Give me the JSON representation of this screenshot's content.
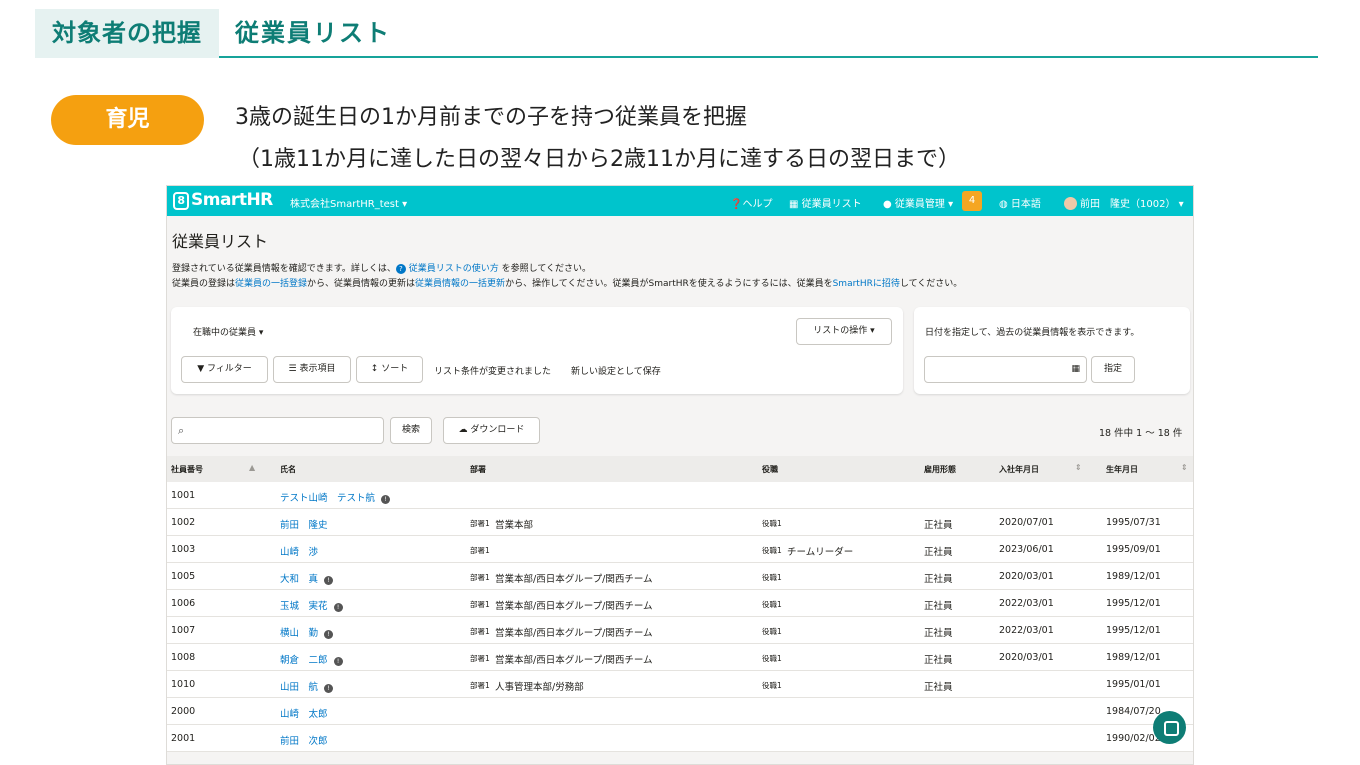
{
  "slide": {
    "tab_label": "対象者の把握",
    "title": "従業員リスト",
    "pill": "育児",
    "desc_line1": "3歳の誕生日の1か月前までの子を持つ従業員を把握",
    "desc_line2": "（1歳11か月に達した日の翌々日から2歳11か月に達する日の翌日まで）"
  },
  "app": {
    "logo": "SmartHR",
    "logo_mark": "8",
    "company": "株式会社SmartHR_test ▾",
    "nav": {
      "help": "ヘルプ",
      "employee_list": "従業員リスト",
      "employee_mgmt": "従業員管理 ▾",
      "badge": "4",
      "language": "日本語",
      "user": "前田　隆史（1002） ▾"
    },
    "page_title": "従業員リスト",
    "intro1_pre": "登録されている従業員情報を確認できます。詳しくは、",
    "intro1_link": "従業員リストの使い方",
    "intro1_post": " を参照してください。",
    "intro2_a": "従業員の登録は",
    "intro2_link1": "従業員の一括登録",
    "intro2_b": "から、従業員情報の更新は",
    "intro2_link2": "従業員情報の一括更新",
    "intro2_c": "から、操作してください。従業員がSmartHRを使えるようにするには、従業員を",
    "intro2_link3": "SmartHRに招待",
    "intro2_d": "してください。",
    "filter_panel": {
      "status_select": "在職中の従業員 ▾",
      "list_ops": "リストの操作 ▾",
      "filter": "フィルター",
      "columns": "表示項目",
      "sort": "ソート",
      "changed": "リスト条件が変更されました",
      "save_new": "新しい設定として保存"
    },
    "date_panel": {
      "text": "日付を指定して、過去の従業員情報を表示できます。",
      "apply": "指定"
    },
    "search_btn": "検索",
    "download_btn": "ダウンロード",
    "count": "18 件中 1 〜 18 件",
    "columns": [
      "社員番号",
      "氏名",
      "部署",
      "役職",
      "雇用形態",
      "入社年月日",
      "生年月日"
    ],
    "rows": [
      {
        "id": "1001",
        "name": "テスト山崎　テスト航",
        "info": true,
        "dept_label": "",
        "dept": "",
        "pos_label": "",
        "pos": "",
        "type": "",
        "hire": "",
        "birth": ""
      },
      {
        "id": "1002",
        "name": "前田　隆史",
        "info": false,
        "dept_label": "部署1",
        "dept": "営業本部",
        "pos_label": "役職1",
        "pos": "",
        "type": "正社員",
        "hire": "2020/07/01",
        "birth": "1995/07/31"
      },
      {
        "id": "1003",
        "name": "山崎　渉",
        "info": false,
        "dept_label": "部署1",
        "dept": "",
        "pos_label": "役職1",
        "pos": "チームリーダー",
        "type": "正社員",
        "hire": "2023/06/01",
        "birth": "1995/09/01"
      },
      {
        "id": "1005",
        "name": "大和　真",
        "info": true,
        "dept_label": "部署1",
        "dept": "営業本部/西日本グループ/関西チーム",
        "pos_label": "役職1",
        "pos": "",
        "type": "正社員",
        "hire": "2020/03/01",
        "birth": "1989/12/01"
      },
      {
        "id": "1006",
        "name": "玉城　実花",
        "info": true,
        "dept_label": "部署1",
        "dept": "営業本部/西日本グループ/関西チーム",
        "pos_label": "役職1",
        "pos": "",
        "type": "正社員",
        "hire": "2022/03/01",
        "birth": "1995/12/01"
      },
      {
        "id": "1007",
        "name": "横山　勤",
        "info": true,
        "dept_label": "部署1",
        "dept": "営業本部/西日本グループ/関西チーム",
        "pos_label": "役職1",
        "pos": "",
        "type": "正社員",
        "hire": "2022/03/01",
        "birth": "1995/12/01"
      },
      {
        "id": "1008",
        "name": "朝倉　二郎",
        "info": true,
        "dept_label": "部署1",
        "dept": "営業本部/西日本グループ/関西チーム",
        "pos_label": "役職1",
        "pos": "",
        "type": "正社員",
        "hire": "2020/03/01",
        "birth": "1989/12/01"
      },
      {
        "id": "1010",
        "name": "山田　航",
        "info": true,
        "dept_label": "部署1",
        "dept": "人事管理本部/労務部",
        "pos_label": "役職1",
        "pos": "",
        "type": "正社員",
        "hire": "",
        "birth": "1995/01/01"
      },
      {
        "id": "2000",
        "name": "山崎　太郎",
        "info": false,
        "dept_label": "",
        "dept": "",
        "pos_label": "",
        "pos": "",
        "type": "",
        "hire": "",
        "birth": "1984/07/20"
      },
      {
        "id": "2001",
        "name": "前田　次郎",
        "info": false,
        "dept_label": "",
        "dept": "",
        "pos_label": "",
        "pos": "",
        "type": "",
        "hire": "",
        "birth": "1990/02/02"
      }
    ]
  },
  "colors": {
    "brand": "#00c4cc",
    "accent": "#0e7d75",
    "pill": "#f5a010",
    "link": "#0077c7"
  }
}
